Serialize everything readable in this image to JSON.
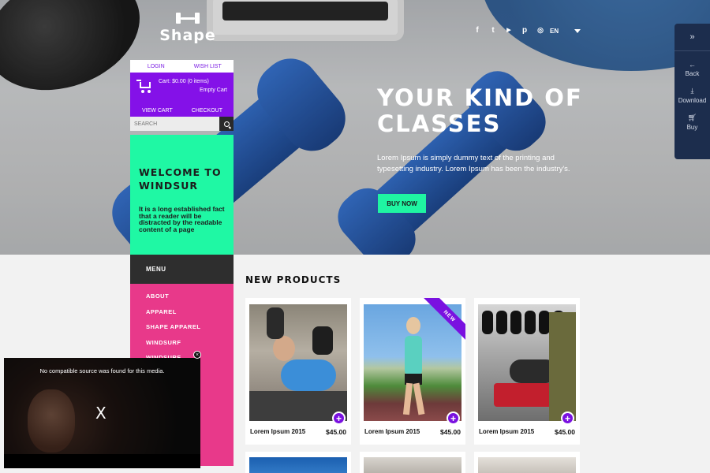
{
  "brand": {
    "name": "Shape"
  },
  "header": {
    "social_icons": [
      "facebook-icon",
      "twitter-icon",
      "youtube-icon",
      "pinterest-icon",
      "instagram-icon"
    ],
    "social_glyphs": [
      "f",
      "t",
      "▶",
      "p",
      "◎"
    ],
    "language": "EN"
  },
  "hero": {
    "title_line1": "YOUR KIND OF",
    "title_line2": "CLASSES",
    "text": "Lorem Ipsum is simply dummy text of the printing and typesetting industry. Lorem Ipsum has been the industry's.",
    "button": "BUY NOW"
  },
  "side_panel": {
    "items": [
      {
        "label": "Back",
        "icon": "←"
      },
      {
        "label": "Download",
        "icon": "⤓"
      },
      {
        "label": "Buy",
        "icon": "🛒︎"
      }
    ]
  },
  "account": {
    "login": "LOGIN",
    "wishlist": "WISH LIST"
  },
  "cart": {
    "status": "Cart: $0.00 (0 items)",
    "empty": "Empty Cart",
    "view": "VIEW CART",
    "checkout": "CHECKOUT"
  },
  "search": {
    "placeholder": "SEARCH"
  },
  "welcome": {
    "title": "WELCOME TO WINDSUR",
    "text": "It is a long established fact that a reader will be distracted by the readable content of a page"
  },
  "menu": {
    "heading": "MENU",
    "items": [
      "ABOUT",
      "APPAREL",
      "SHAPE APPAREL",
      "WINDSURF",
      "WINDSURF"
    ]
  },
  "products": {
    "title": "NEW PRODUCTS",
    "items": [
      {
        "name": "Lorem Ipsum 2015",
        "price": "$45.00",
        "badge": ""
      },
      {
        "name": "Lorem Ipsum 2015",
        "price": "$45.00",
        "badge": "NEW"
      },
      {
        "name": "Lorem Ipsum 2015",
        "price": "$45.00",
        "badge": ""
      }
    ]
  },
  "video": {
    "message": "No compatible source was found for this media.",
    "close_label": "X"
  },
  "colors": {
    "accent_green": "#1ff5a2",
    "accent_purple": "#8411e8",
    "accent_pink": "#e8398a",
    "dark": "#2e2e2e",
    "panel": "#1c2d4d"
  }
}
